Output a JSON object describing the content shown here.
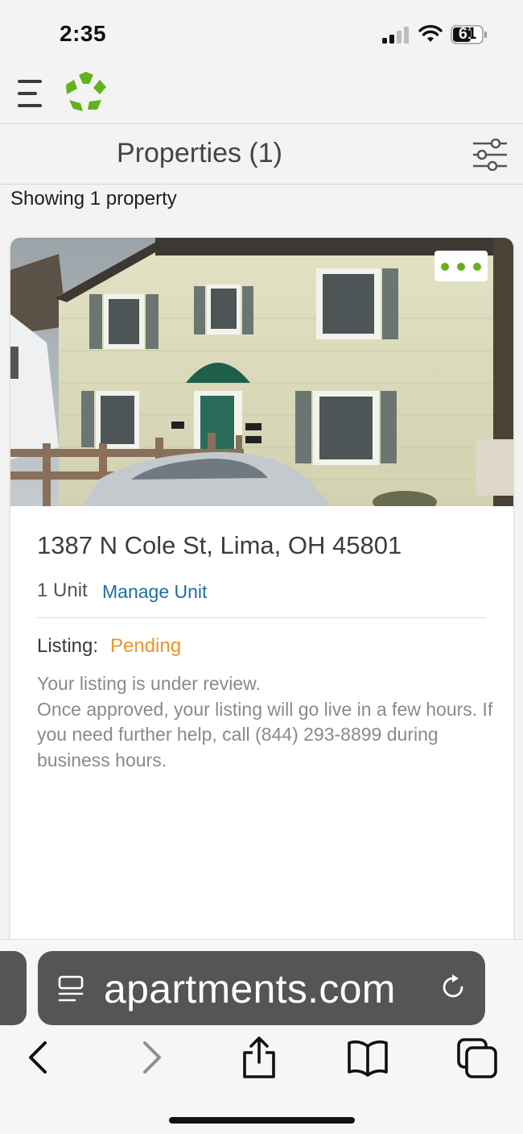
{
  "status_bar": {
    "time": "2:35",
    "battery_level": "61"
  },
  "header": {
    "menu_icon": "hamburger-menu-icon",
    "logo_icon": "recycle-logo-icon",
    "brand_color": "#62b21b"
  },
  "title_bar": {
    "title": "Properties (1)",
    "filter_icon": "filter-sliders-icon"
  },
  "summary": {
    "showing_text": "Showing 1 property"
  },
  "property_card": {
    "photo_icon": "house-photo",
    "more_icon": "more-options-icon",
    "address": "1387 N Cole St, Lima, OH 45801",
    "units": "1 Unit",
    "manage_unit_label": "Manage Unit",
    "listing_label": "Listing:",
    "listing_status": "Pending",
    "status_color": "#f0922b",
    "description_line1": "Your listing is under review.",
    "description_line2": "Once approved, your listing will go live in a few hours. If you need further help, call (844) 293-8899 during business hours."
  },
  "browser": {
    "url": "apartments.com",
    "page_icon": "page-menu-icon",
    "reload_icon": "reload-icon",
    "nav": {
      "back_icon": "back-chevron-icon",
      "forward_icon": "forward-chevron-icon",
      "share_icon": "share-icon",
      "bookmarks_icon": "book-icon",
      "tabs_icon": "tabs-icon"
    }
  }
}
